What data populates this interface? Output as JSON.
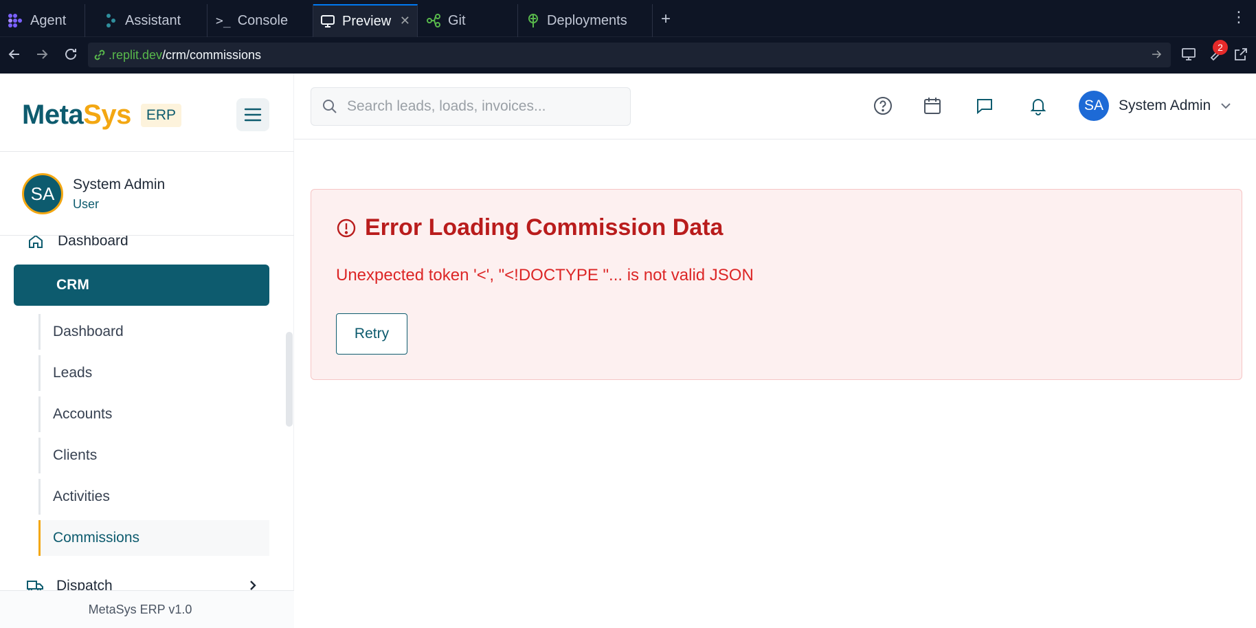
{
  "browser": {
    "tabs": [
      {
        "label": "Agent",
        "icon": "agent-icon"
      },
      {
        "label": "Assistant",
        "icon": "assistant-icon"
      },
      {
        "label": "Console",
        "icon": "console-icon"
      },
      {
        "label": "Preview",
        "icon": "preview-icon",
        "active": true
      },
      {
        "label": "Git",
        "icon": "git-icon"
      },
      {
        "label": "Deployments",
        "icon": "deployments-icon"
      }
    ],
    "url_host": ".replit.dev",
    "url_path": "/crm/commissions",
    "tools_badge": "2"
  },
  "sidebar": {
    "brand_meta": "Meta",
    "brand_sys": "Sys",
    "brand_tag": "ERP",
    "profile": {
      "initials": "SA",
      "name": "System Admin",
      "role": "User"
    },
    "nav_top": "Dashboard",
    "crm_label": "CRM",
    "crm_items": [
      "Dashboard",
      "Leads",
      "Accounts",
      "Clients",
      "Activities",
      "Commissions"
    ],
    "active_item": "Commissions",
    "dispatch_label": "Dispatch",
    "footer": "MetaSys ERP v1.0"
  },
  "header": {
    "search_placeholder": "Search leads, loads, invoices...",
    "user_initials": "SA",
    "user_name": "System Admin"
  },
  "error": {
    "title": "Error Loading Commission Data",
    "message": "Unexpected token '<', \"<!DOCTYPE \"... is not valid JSON",
    "retry_label": "Retry"
  },
  "colors": {
    "brand_teal": "#0d5b6e",
    "brand_gold": "#f3a712",
    "error_red": "#b91c1c",
    "error_bg": "#fdf0f0",
    "replit_bg": "#0e1525"
  }
}
